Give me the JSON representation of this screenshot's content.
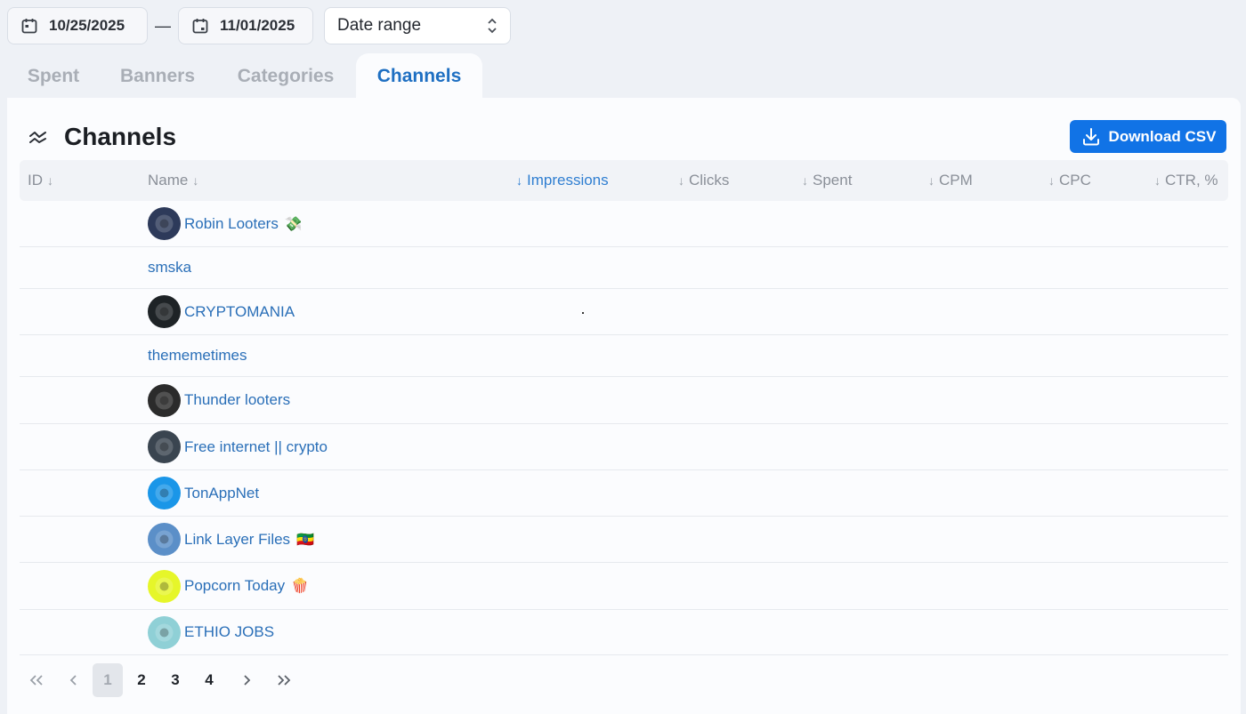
{
  "date_filter": {
    "start": "10/25/2025",
    "separator": "—",
    "end": "11/01/2025",
    "preset": "Date range"
  },
  "tabs": [
    {
      "label": "Spent",
      "active": false
    },
    {
      "label": "Banners",
      "active": false
    },
    {
      "label": "Categories",
      "active": false
    },
    {
      "label": "Channels",
      "active": true
    }
  ],
  "panel": {
    "title": "Channels",
    "download_label": "Download CSV"
  },
  "table": {
    "columns": [
      {
        "label": "ID",
        "sorted": false
      },
      {
        "label": "Name",
        "sorted": false
      },
      {
        "label": "Impressions",
        "sorted": true
      },
      {
        "label": "Clicks",
        "sorted": false
      },
      {
        "label": "Spent",
        "sorted": false
      },
      {
        "label": "CPM",
        "sorted": false
      },
      {
        "label": "CPC",
        "sorted": false
      },
      {
        "label": "CTR, %",
        "sorted": false
      }
    ],
    "rows": [
      {
        "name": "Robin Looters",
        "emoji": "💸",
        "avatar": "robin-looters-avatar",
        "color": "#2d3a5a"
      },
      {
        "name": "smska",
        "emoji": "",
        "avatar": "",
        "color": ""
      },
      {
        "name": "CRYPTOMANIA",
        "emoji": "",
        "avatar": "cryptomania-avatar",
        "color": "#1e2326"
      },
      {
        "name": "thememetimes",
        "emoji": "",
        "avatar": "",
        "color": ""
      },
      {
        "name": "Thunder looters",
        "emoji": "",
        "avatar": "thunder-looters-avatar",
        "color": "#2b2b2b"
      },
      {
        "name": "Free internet || crypto",
        "emoji": "",
        "avatar": "free-internet-avatar",
        "color": "#3a4550"
      },
      {
        "name": "TonAppNet",
        "emoji": "",
        "avatar": "ton-logo-avatar",
        "color": "#1a96e8"
      },
      {
        "name": "Link Layer Files",
        "emoji": "🇪🇹",
        "avatar": "link-layer-avatar",
        "color": "#5b8fc8"
      },
      {
        "name": "Popcorn Today",
        "emoji": "🍿",
        "avatar": "popcorn-today-avatar",
        "color": "#e6f62a"
      },
      {
        "name": "ETHIO JOBS",
        "emoji": "",
        "avatar": "ethio-jobs-avatar",
        "color": "#8fd0d6"
      }
    ]
  },
  "pagination": {
    "pages": [
      "1",
      "2",
      "3",
      "4"
    ],
    "current": "1"
  },
  "colors": {
    "accent": "#1173e6",
    "link": "#2a6fb8",
    "background": "#eef1f6"
  }
}
